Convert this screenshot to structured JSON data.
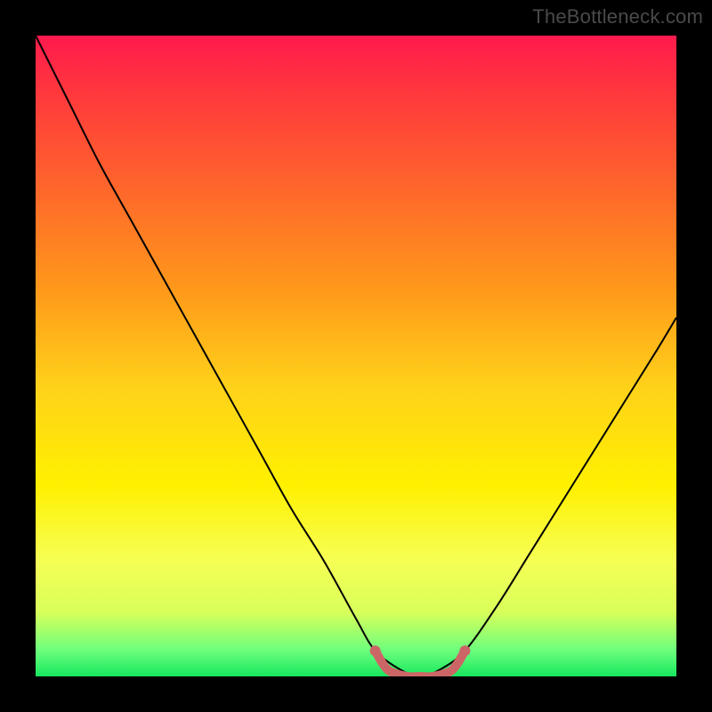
{
  "watermark": "TheBottleneck.com",
  "chart_data": {
    "type": "line",
    "title": "",
    "xlabel": "",
    "ylabel": "",
    "xlim": [
      0,
      100
    ],
    "ylim": [
      0,
      100
    ],
    "series": [
      {
        "name": "bottleneck-curve",
        "x": [
          0,
          5,
          10,
          15,
          20,
          25,
          30,
          35,
          40,
          45,
          50,
          53,
          57,
          60,
          63,
          67,
          72,
          77,
          82,
          87,
          92,
          97,
          100
        ],
        "y": [
          100,
          90,
          80,
          71,
          62,
          53,
          44,
          35,
          26,
          18,
          9,
          4,
          1,
          0,
          1,
          4,
          11,
          19,
          27,
          35,
          43,
          51,
          56
        ]
      },
      {
        "name": "optimal-zone",
        "x": [
          53,
          55,
          58,
          60,
          62,
          65,
          67
        ],
        "y": [
          4,
          1,
          0,
          0,
          0,
          1,
          4
        ]
      }
    ],
    "colors": {
      "curve": "#000000",
      "optimal": "#cc6666",
      "gradient_top": "#ff1a4d",
      "gradient_bottom": "#17e65e"
    }
  }
}
